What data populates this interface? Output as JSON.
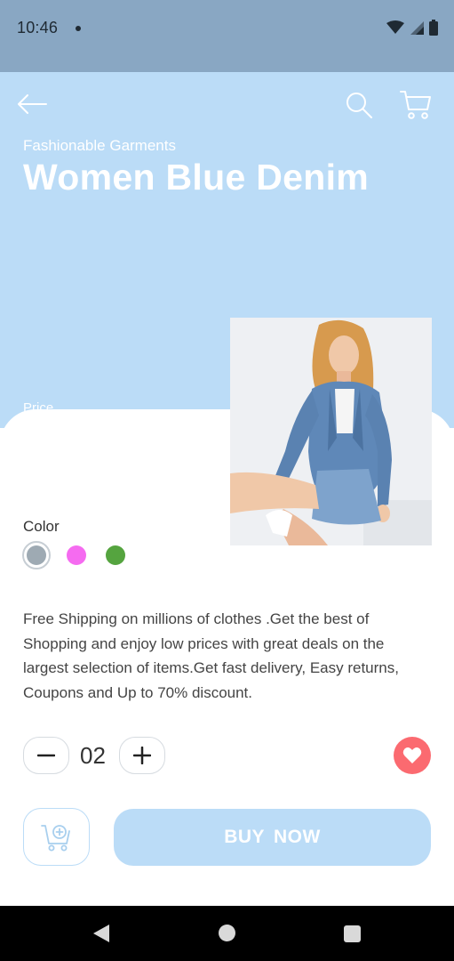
{
  "status_bar": {
    "time": "10:46",
    "icons": [
      "wifi-icon",
      "signal-icon",
      "battery-icon"
    ]
  },
  "header": {
    "back_icon": "arrow-left-icon",
    "search_icon": "search-icon",
    "cart_icon": "cart-icon",
    "subtitle": "Fashionable Garments",
    "title": "Women Blue Denim",
    "price_label": "Price"
  },
  "product": {
    "image_description": "woman-in-denim-jacket-and-skirt-photo"
  },
  "colors": {
    "label": "Color",
    "options": [
      "#9eaab3",
      "#f56bf0",
      "#55a43f"
    ],
    "selected_index": 0
  },
  "description": "Free Shipping on millions of clothes .Get the best of Shopping and enjoy low prices with great deals on the largest selection of items.Get fast delivery, Easy returns, Coupons and Up to 70% discount.",
  "quantity": {
    "minus_icon": "minus-icon",
    "value": "02",
    "plus_icon": "plus-icon"
  },
  "favorite": {
    "icon": "heart-icon",
    "color": "#fb6a70"
  },
  "actions": {
    "add_to_cart_icon": "cart-add-icon",
    "buy_label": "BUY NOW"
  },
  "theme": {
    "accent": "#bbdcf7",
    "status_bar": "#89a7c3"
  },
  "nav_bar": {
    "icons": [
      "nav-back-icon",
      "nav-home-icon",
      "nav-recent-icon"
    ]
  }
}
